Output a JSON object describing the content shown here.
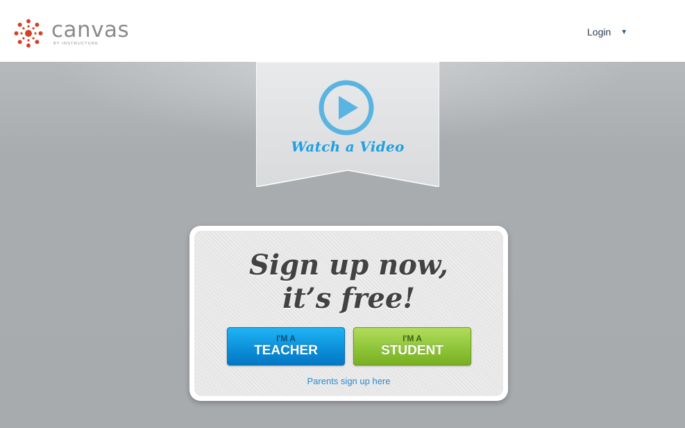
{
  "header": {
    "logo_word": "canvas",
    "logo_sub": "BY INSTRUCTURE",
    "login_label": "Login",
    "login_caret": "▼"
  },
  "ribbon": {
    "watch_label": "Watch a Video"
  },
  "signup": {
    "headline_line1": "Sign up now,",
    "headline_line2": "it’s free!",
    "teacher_small": "I'M A",
    "teacher_big": "TEACHER",
    "student_small": "I'M A",
    "student_big": "STUDENT",
    "parents_link": "Parents sign up here"
  },
  "colors": {
    "brand_red": "#d64027",
    "teacher_blue": "#0c90da",
    "student_green": "#8fc53a",
    "video_blue": "#1da1e3"
  }
}
